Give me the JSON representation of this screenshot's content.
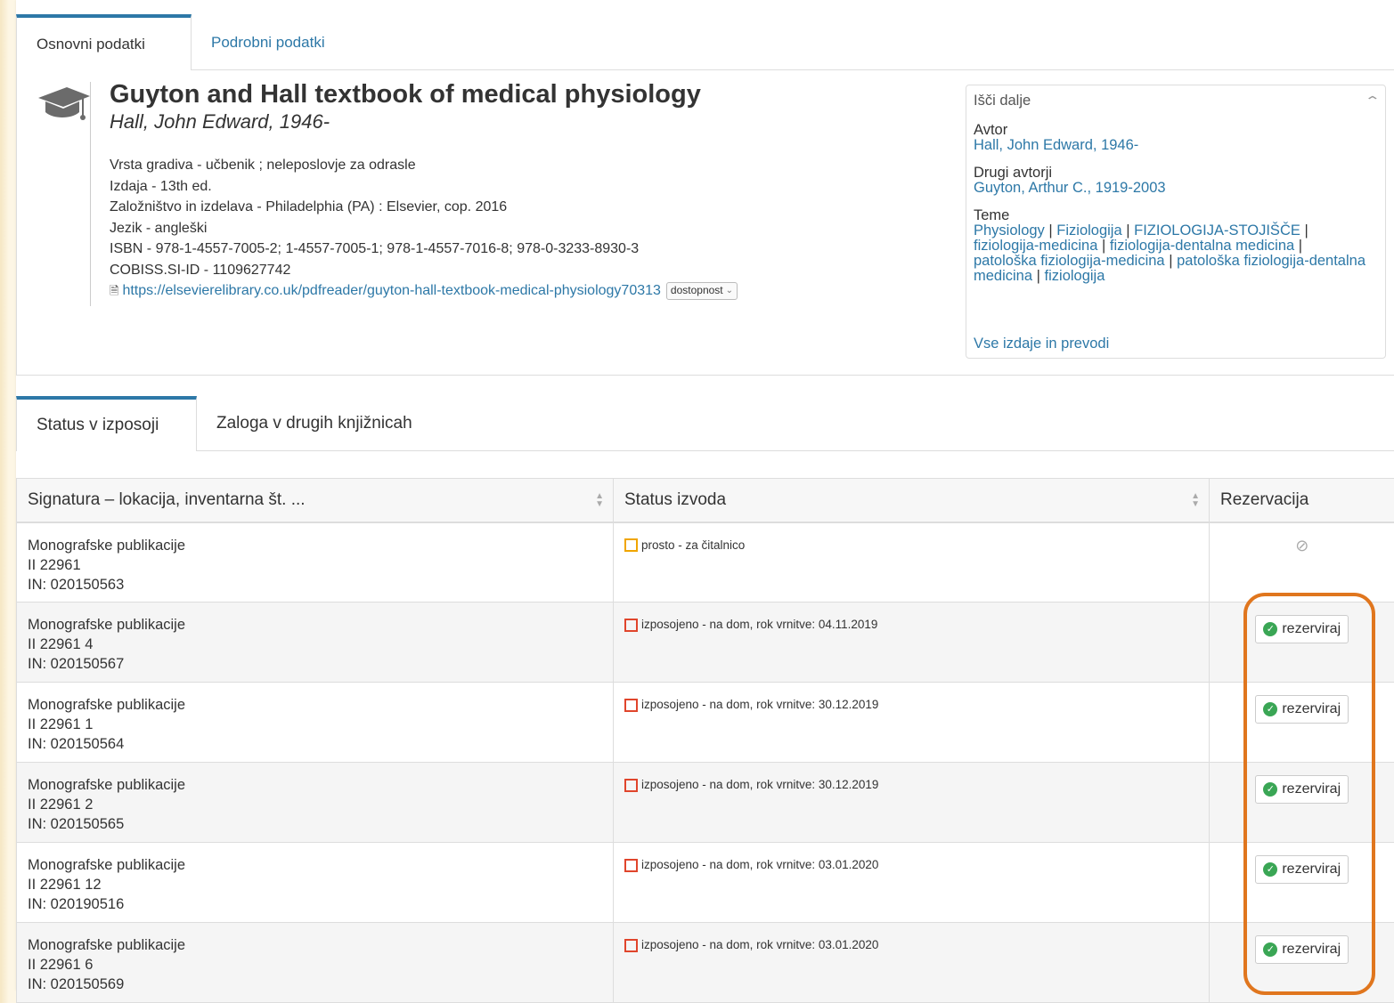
{
  "tabs_top": {
    "basic": "Osnovni podatki",
    "detailed": "Podrobni podatki"
  },
  "record": {
    "icon": "graduation-cap-icon",
    "title": "Guyton and Hall textbook of medical physiology",
    "author": "Hall, John Edward, 1946-",
    "meta": [
      {
        "label": "Vrsta gradiva",
        "value": "učbenik ; neleposlovje za odrasle"
      },
      {
        "label": "Izdaja",
        "value": "13th ed."
      },
      {
        "label": "Založništvo in izdelava",
        "value": "Philadelphia (PA) : Elsevier, cop. 2016"
      },
      {
        "label": "Jezik",
        "value": "angleški"
      },
      {
        "label": "ISBN",
        "value": "978-1-4557-7005-2; 1-4557-7005-1; 978-1-4557-7016-8; 978-0-3233-8930-3"
      },
      {
        "label": "COBISS.SI-ID",
        "value": "1109627742"
      }
    ],
    "url": "https://elsevierelibrary.co.uk/pdfreader/guyton-hall-textbook-medical-physiology70313",
    "availability_label": "dostopnost"
  },
  "search_more": {
    "heading": "Išči dalje",
    "author_label": "Avtor",
    "author_value": "Hall, John Edward, 1946-",
    "other_authors_label": "Drugi avtorji",
    "other_authors_value": "Guyton, Arthur C., 1919-2003",
    "topics_label": "Teme",
    "topics": [
      "Physiology",
      "Fiziologija",
      "FIZIOLOGIJA-STOJIŠČE",
      "fiziologija-medicina",
      "fiziologija-dentalna medicina",
      "patološka fiziologija-medicina",
      "patološka fiziologija-dentalna medicina",
      "fiziologija"
    ],
    "all_editions": "Vse izdaje in prevodi"
  },
  "tabs_bottom": {
    "status": "Status v izposoji",
    "holdings": "Zaloga v drugih knjižnicah"
  },
  "table": {
    "headers": [
      "Signatura – lokacija, inventarna št. ...",
      "Status izvoda",
      "Rezervacija"
    ],
    "rows": [
      {
        "loc": "Monografske publikacije",
        "sig": "II 22961",
        "inv": "IN: 020150563",
        "status": "prosto - za čitalnico",
        "status_color": "#f0a500",
        "reservable": false
      },
      {
        "loc": "Monografske publikacije",
        "sig": "II 22961 4",
        "inv": "IN: 020150567",
        "status": "izposojeno - na dom, rok vrnitve: 04.11.2019",
        "status_color": "#e0452c",
        "reservable": true
      },
      {
        "loc": "Monografske publikacije",
        "sig": "II 22961 1",
        "inv": "IN: 020150564",
        "status": "izposojeno - na dom, rok vrnitve: 30.12.2019",
        "status_color": "#e0452c",
        "reservable": true
      },
      {
        "loc": "Monografske publikacije",
        "sig": "II 22961 2",
        "inv": "IN: 020150565",
        "status": "izposojeno - na dom, rok vrnitve: 30.12.2019",
        "status_color": "#e0452c",
        "reservable": true
      },
      {
        "loc": "Monografske publikacije",
        "sig": "II 22961 12",
        "inv": "IN: 020190516",
        "status": "izposojeno - na dom, rok vrnitve: 03.01.2020",
        "status_color": "#e0452c",
        "reservable": true
      },
      {
        "loc": "Monografske publikacije",
        "sig": "II 22961 6",
        "inv": "IN: 020150569",
        "status": "izposojeno - na dom, rok vrnitve: 03.01.2020",
        "status_color": "#e0452c",
        "reservable": true
      }
    ],
    "reserve_label": "rezerviraj"
  },
  "colors": {
    "accent": "#2d78a7",
    "available": "#f0a500",
    "loaned": "#e0452c",
    "reserve_ok": "#3aa655",
    "highlight": "#e0761e"
  }
}
